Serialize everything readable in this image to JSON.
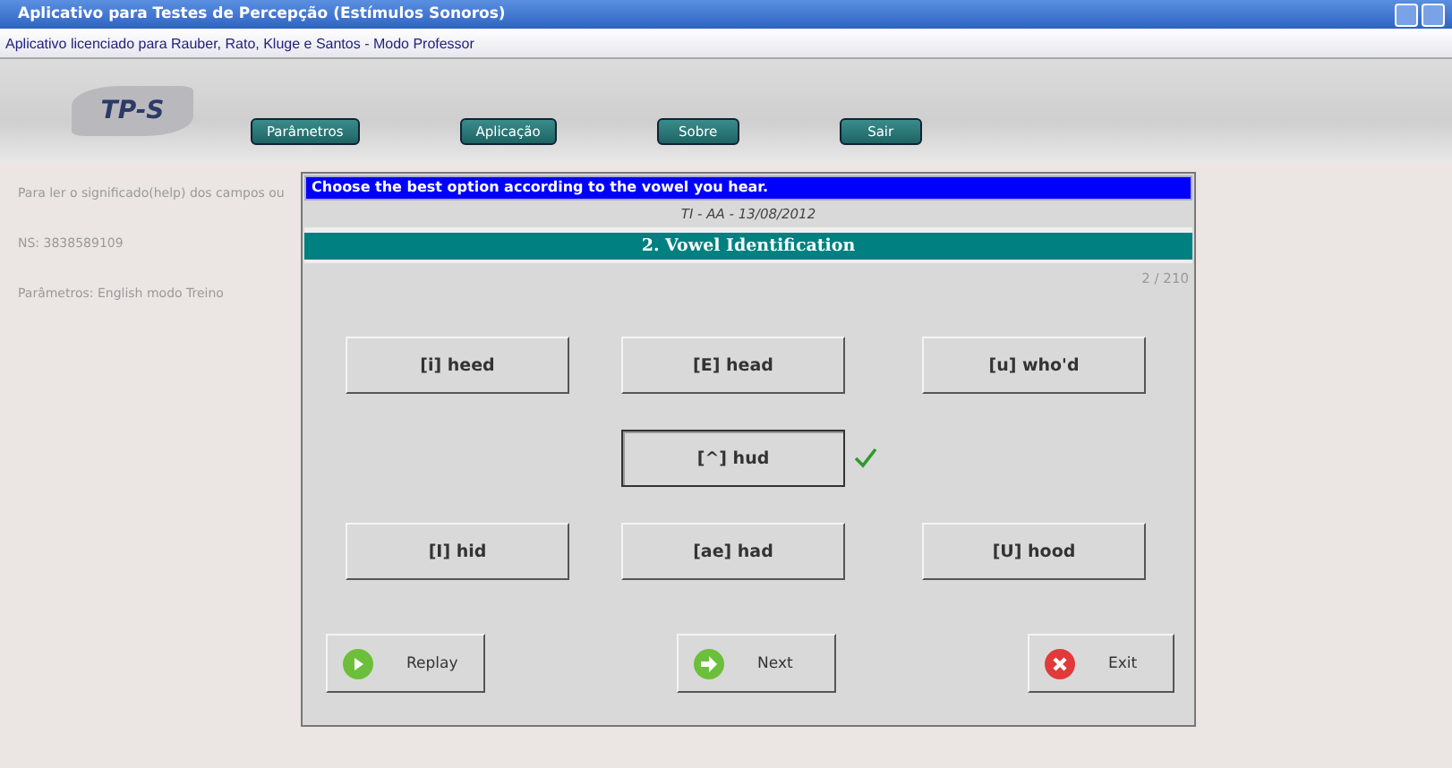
{
  "window": {
    "title": "Aplicativo para Testes de Percepção (Estímulos Sonoros)"
  },
  "license": "Aplicativo licenciado para Rauber, Rato, Kluge e Santos - Modo Professor",
  "logo": "TP-S",
  "nav": [
    "Parâmetros",
    "Aplicação",
    "Sobre",
    "Sair"
  ],
  "side": [
    "Para ler o significado(help) dos campos ou",
    "NS: 3838589109",
    "Parâmetros:  English modo Treino"
  ],
  "dialog": {
    "instruction": "Choose the best option according to the vowel you hear.",
    "session": "TI - AA - 13/08/2012",
    "section": "2. Vowel Identification",
    "counter": "2 / 210",
    "options": [
      {
        "label": "[i] heed",
        "selected": false,
        "correct": false
      },
      {
        "label": "[E] head",
        "selected": false,
        "correct": false
      },
      {
        "label": "[u] who'd",
        "selected": false,
        "correct": false
      },
      {
        "label": "[^] hud",
        "selected": true,
        "correct": true
      },
      {
        "label": "[I] hid",
        "selected": false,
        "correct": false
      },
      {
        "label": "[ae] had",
        "selected": false,
        "correct": false
      },
      {
        "label": "[U] hood",
        "selected": false,
        "correct": false
      }
    ],
    "actions": [
      {
        "kind": "replay",
        "label": "Replay"
      },
      {
        "kind": "next",
        "label": "Next"
      },
      {
        "kind": "exit",
        "label": "Exit"
      }
    ]
  }
}
